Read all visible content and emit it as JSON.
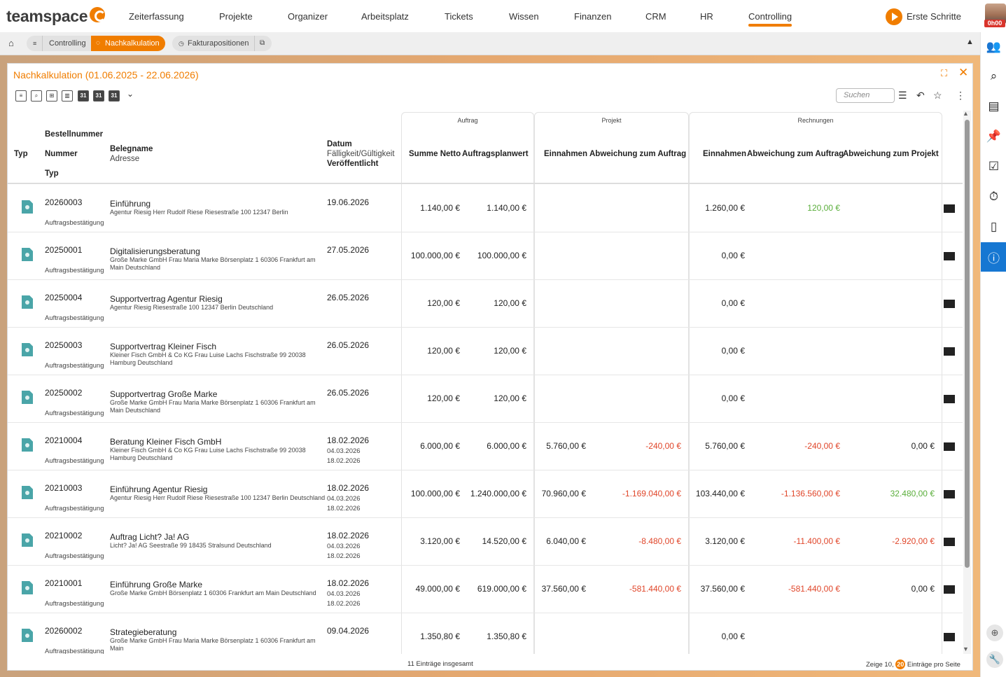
{
  "app": {
    "logo_text": "teamspace",
    "nav": [
      "Zeiterfassung",
      "Projekte",
      "Organizer",
      "Arbeitsplatz",
      "Tickets",
      "Wissen",
      "Finanzen",
      "CRM",
      "HR",
      "Controlling"
    ],
    "active_nav": "Controlling",
    "start_label": "Erste Schritte",
    "timer": "0h00",
    "accent_color": "#f07d00"
  },
  "breadcrumb": {
    "items": [
      "Controlling",
      "Nachkalkulation",
      "Fakturapositionen"
    ]
  },
  "window": {
    "title": "Nachkalkulation (01.06.2025 - 22.06.2026)",
    "search_placeholder": "Suchen"
  },
  "groups": {
    "auftrag": "Auftrag",
    "projekt": "Projekt",
    "rechnungen": "Rechnungen"
  },
  "headers": {
    "typ": "Typ",
    "bestellnummer": "Bestellnummer",
    "nummer": "Nummer",
    "typ2": "Typ",
    "belegname": "Belegname",
    "adresse": "Adresse",
    "datum": "Datum",
    "faelligkeit": "Fälligkeit/Gültigkeit",
    "veroeffentlicht": "Veröffentlicht",
    "summe_netto": "Summe Netto",
    "auftragsplanwert": "Auftragsplanwert",
    "proj_einnahmen": "Einnahmen",
    "proj_abweichung": "Abweichung zum Auftrag",
    "rech_einnahmen": "Einnahmen",
    "rech_abw_auftrag": "Abweichung zum Auftrag",
    "rech_abw_projekt": "Abweichung zum Projekt"
  },
  "rows": [
    {
      "nummer": "20260003",
      "typ": "Auftragsbestätigung",
      "name": "Einführung",
      "adresse": "Agentur Riesig Herr Rudolf Riese Riesestraße 100 12347 Berlin",
      "datum": "19.06.2026",
      "faellig": "",
      "veroeff": "",
      "summe": "1.140,00 €",
      "planwert": "1.140,00 €",
      "p_einn": "",
      "p_abw": "",
      "p_abw_color": "",
      "r_einn": "1.260,00 €",
      "r_abw_a": "120,00 €",
      "r_abw_a_color": "green",
      "r_abw_p": "",
      "r_abw_p_color": ""
    },
    {
      "nummer": "20250001",
      "typ": "Auftragsbestätigung",
      "name": "Digitalisierungsberatung",
      "adresse": "Große Marke GmbH Frau Maria Marke Börsenplatz 1 60306 Frankfurt am Main Deutschland",
      "datum": "27.05.2026",
      "faellig": "",
      "veroeff": "",
      "summe": "100.000,00 €",
      "planwert": "100.000,00 €",
      "p_einn": "",
      "p_abw": "",
      "p_abw_color": "",
      "r_einn": "0,00 €",
      "r_abw_a": "",
      "r_abw_a_color": "",
      "r_abw_p": "",
      "r_abw_p_color": ""
    },
    {
      "nummer": "20250004",
      "typ": "Auftragsbestätigung",
      "name": "Supportvertrag Agentur Riesig",
      "adresse": "Agentur Riesig Riesestraße 100 12347 Berlin Deutschland",
      "datum": "26.05.2026",
      "faellig": "",
      "veroeff": "",
      "summe": "120,00 €",
      "planwert": "120,00 €",
      "p_einn": "",
      "p_abw": "",
      "p_abw_color": "",
      "r_einn": "0,00 €",
      "r_abw_a": "",
      "r_abw_a_color": "",
      "r_abw_p": "",
      "r_abw_p_color": ""
    },
    {
      "nummer": "20250003",
      "typ": "Auftragsbestätigung",
      "name": "Supportvertrag Kleiner Fisch",
      "adresse": "Kleiner Fisch GmbH & Co KG Frau Luise Lachs Fischstraße 99 20038 Hamburg Deutschland",
      "datum": "26.05.2026",
      "faellig": "",
      "veroeff": "",
      "summe": "120,00 €",
      "planwert": "120,00 €",
      "p_einn": "",
      "p_abw": "",
      "p_abw_color": "",
      "r_einn": "0,00 €",
      "r_abw_a": "",
      "r_abw_a_color": "",
      "r_abw_p": "",
      "r_abw_p_color": ""
    },
    {
      "nummer": "20250002",
      "typ": "Auftragsbestätigung",
      "name": "Supportvertrag Große Marke",
      "adresse": "Große Marke GmbH Frau Maria Marke Börsenplatz 1 60306 Frankfurt am Main Deutschland",
      "datum": "26.05.2026",
      "faellig": "",
      "veroeff": "",
      "summe": "120,00 €",
      "planwert": "120,00 €",
      "p_einn": "",
      "p_abw": "",
      "p_abw_color": "",
      "r_einn": "0,00 €",
      "r_abw_a": "",
      "r_abw_a_color": "",
      "r_abw_p": "",
      "r_abw_p_color": ""
    },
    {
      "nummer": "20210004",
      "typ": "Auftragsbestätigung",
      "name": "Beratung Kleiner Fisch GmbH",
      "adresse": "Kleiner Fisch GmbH & Co KG Frau Luise Lachs Fischstraße 99 20038 Hamburg Deutschland",
      "datum": "18.02.2026",
      "faellig": "04.03.2026",
      "veroeff": "18.02.2026",
      "summe": "6.000,00 €",
      "planwert": "6.000,00 €",
      "p_einn": "5.760,00 €",
      "p_abw": "-240,00 €",
      "p_abw_color": "red",
      "r_einn": "5.760,00 €",
      "r_abw_a": "-240,00 €",
      "r_abw_a_color": "red",
      "r_abw_p": "0,00 €",
      "r_abw_p_color": ""
    },
    {
      "nummer": "20210003",
      "typ": "Auftragsbestätigung",
      "name": "Einführung Agentur Riesig",
      "adresse": "Agentur Riesig Herr Rudolf Riese Riesestraße 100 12347 Berlin Deutschland",
      "datum": "18.02.2026",
      "faellig": "04.03.2026",
      "veroeff": "18.02.2026",
      "summe": "100.000,00 €",
      "planwert": "1.240.000,00 €",
      "p_einn": "70.960,00 €",
      "p_abw": "-1.169.040,00 €",
      "p_abw_color": "red",
      "r_einn": "103.440,00 €",
      "r_abw_a": "-1.136.560,00 €",
      "r_abw_a_color": "red",
      "r_abw_p": "32.480,00 €",
      "r_abw_p_color": "green"
    },
    {
      "nummer": "20210002",
      "typ": "Auftragsbestätigung",
      "name": "Auftrag Licht? Ja! AG",
      "adresse": "Licht? Ja! AG Seestraße 99 18435 Stralsund Deutschland",
      "datum": "18.02.2026",
      "faellig": "04.03.2026",
      "veroeff": "18.02.2026",
      "summe": "3.120,00 €",
      "planwert": "14.520,00 €",
      "p_einn": "6.040,00 €",
      "p_abw": "-8.480,00 €",
      "p_abw_color": "red",
      "r_einn": "3.120,00 €",
      "r_abw_a": "-11.400,00 €",
      "r_abw_a_color": "red",
      "r_abw_p": "-2.920,00 €",
      "r_abw_p_color": "red"
    },
    {
      "nummer": "20210001",
      "typ": "Auftragsbestätigung",
      "name": "Einführung Große Marke",
      "adresse": "Große Marke GmbH Börsenplatz 1 60306 Frankfurt am Main Deutschland",
      "datum": "18.02.2026",
      "faellig": "04.03.2026",
      "veroeff": "18.02.2026",
      "summe": "49.000,00 €",
      "planwert": "619.000,00 €",
      "p_einn": "37.560,00 €",
      "p_abw": "-581.440,00 €",
      "p_abw_color": "red",
      "r_einn": "37.560,00 €",
      "r_abw_a": "-581.440,00 €",
      "r_abw_a_color": "red",
      "r_abw_p": "0,00 €",
      "r_abw_p_color": ""
    },
    {
      "nummer": "20260002",
      "typ": "Auftragsbestätigung",
      "name": "Strategieberatung",
      "adresse": "Große Marke GmbH Frau Maria Marke Börsenplatz 1 60306 Frankfurt am Main",
      "datum": "09.04.2026",
      "faellig": "",
      "veroeff": "",
      "summe": "1.350,80 €",
      "planwert": "1.350,80 €",
      "p_einn": "",
      "p_abw": "",
      "p_abw_color": "",
      "r_einn": "0,00 €",
      "r_abw_a": "",
      "r_abw_a_color": "",
      "r_abw_p": "",
      "r_abw_p_color": ""
    }
  ],
  "footer": {
    "total": "11 Einträge insgesamt",
    "show_label": "Zeige",
    "show_a": "10",
    "show_sep": ",",
    "show_b": "20",
    "per_page": "Einträge pro Seite"
  }
}
